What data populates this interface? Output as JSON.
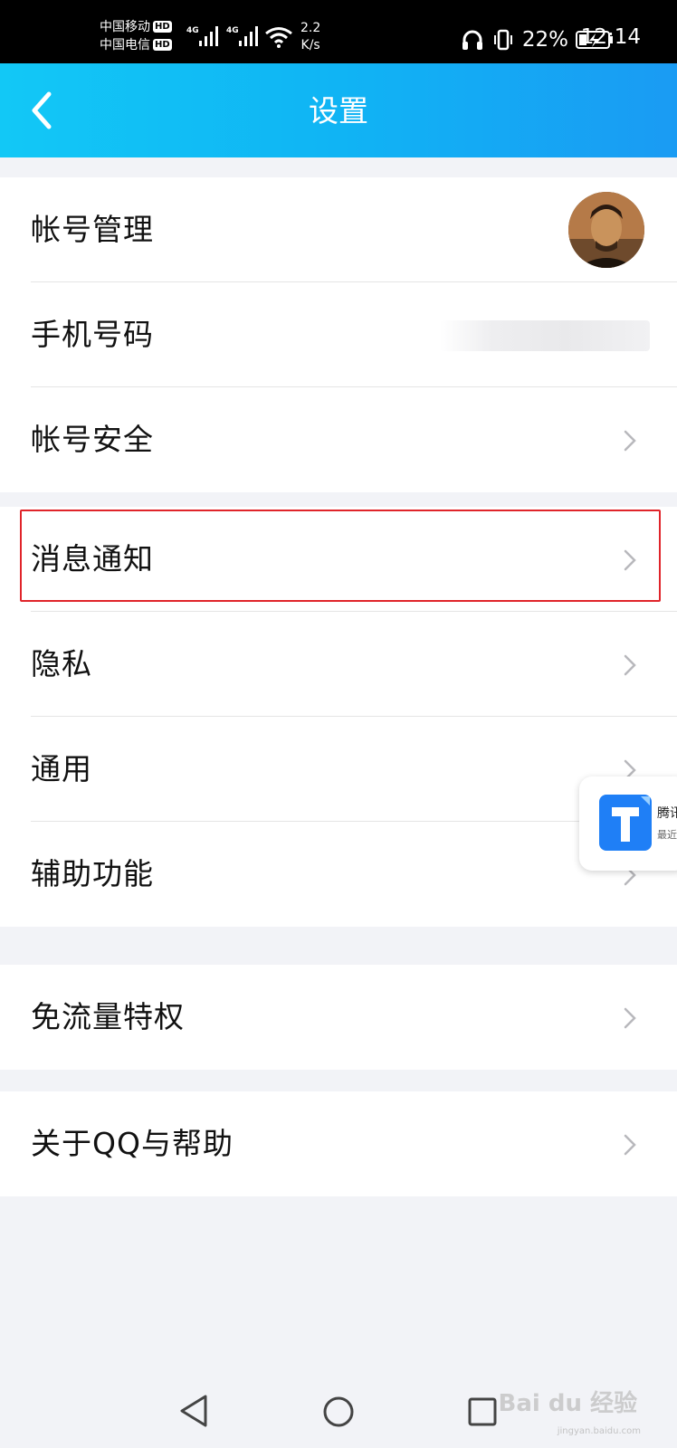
{
  "status_bar": {
    "carrier1": "中国移动",
    "carrier2": "中国电信",
    "hd": "HD",
    "network": "4G",
    "speed_value": "2.2",
    "speed_unit": "K/s",
    "battery": "22%",
    "time": "12:14"
  },
  "header": {
    "title": "设置",
    "back_icon": "back-chevron-icon"
  },
  "groups": [
    {
      "items": [
        {
          "label": "帐号管理",
          "trailing": "avatar"
        },
        {
          "label": "手机号码",
          "trailing": "blurred-value"
        },
        {
          "label": "帐号安全",
          "trailing": "chevron"
        }
      ]
    },
    {
      "items": [
        {
          "label": "消息通知",
          "trailing": "chevron",
          "highlighted": true
        },
        {
          "label": "隐私",
          "trailing": "chevron"
        },
        {
          "label": "通用",
          "trailing": "chevron"
        },
        {
          "label": "辅助功能",
          "trailing": "chevron"
        }
      ]
    },
    {
      "items": [
        {
          "label": "免流量特权",
          "trailing": "chevron"
        }
      ]
    },
    {
      "items": [
        {
          "label": "关于QQ与帮助",
          "trailing": "chevron"
        }
      ]
    }
  ],
  "floating_card": {
    "title": "腾讯",
    "subtitle": "最近"
  },
  "watermark": {
    "text": "Bai du 经验",
    "url": "jingyan.baidu.com"
  },
  "colors": {
    "header_start": "#12c8f6",
    "header_end": "#1a9bf3",
    "highlight_border": "#e0242a",
    "background": "#f2f3f7"
  }
}
